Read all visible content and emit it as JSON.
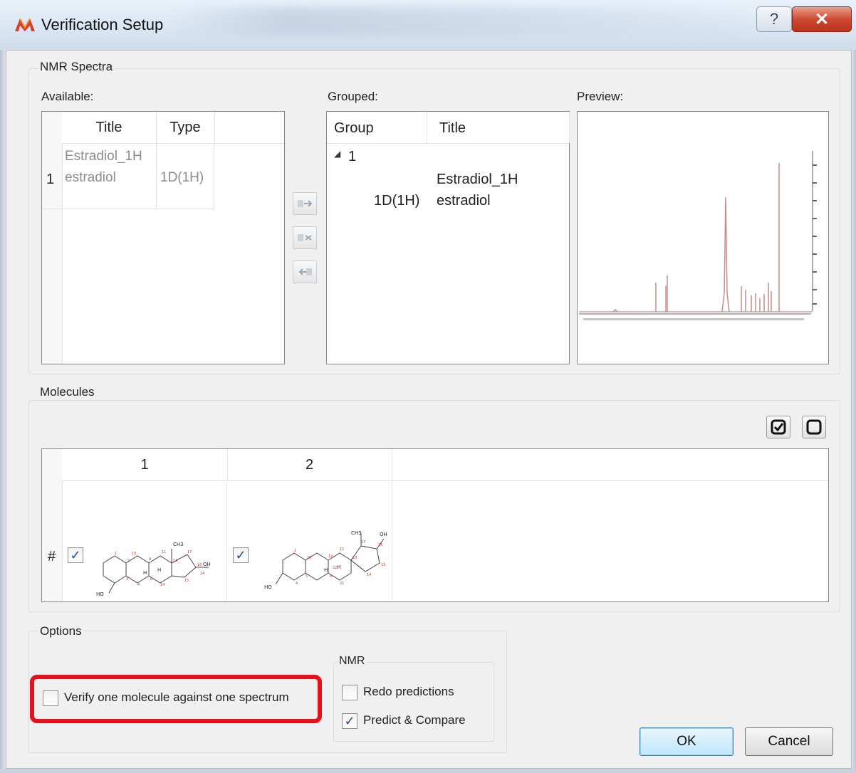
{
  "window": {
    "title": "Verification Setup",
    "help_glyph": "?",
    "close_glyph": "✕",
    "app_icon": "acd-logo-icon"
  },
  "nmr_spectra": {
    "group_label": "NMR Spectra",
    "available": {
      "label": "Available:",
      "columns": [
        "Title",
        "Type"
      ],
      "rows": [
        {
          "index": "1",
          "title_line1": "Estradiol_1H",
          "title_line2": "estradiol",
          "type": "1D(1H)"
        }
      ]
    },
    "transfer_buttons": [
      "add-to-group-icon",
      "remove-from-group-icon",
      "ungroup-icon"
    ],
    "grouped": {
      "label": "Grouped:",
      "columns": [
        "Group",
        "Title"
      ],
      "group_node": "1",
      "expander_glyph": "◢",
      "child": {
        "title_line1": "Estradiol_1H",
        "type": "1D(1H)",
        "title_line2": "estradiol"
      }
    },
    "preview": {
      "label": "Preview:"
    }
  },
  "molecules": {
    "group_label": "Molecules",
    "check_all_icon": "check-all-icon",
    "uncheck_all_icon": "uncheck-all-icon",
    "columns": [
      "1",
      "2"
    ],
    "row_header": "#",
    "items": [
      {
        "checked": true,
        "check_glyph": "✓",
        "mol_label_ho": "HO",
        "mol_label_ch3": "CH3",
        "mol_label_oh": "OH"
      },
      {
        "checked": true,
        "check_glyph": "✓",
        "mol_label_ho": "HO",
        "mol_label_ch3": "CH3",
        "mol_label_oh": "OH"
      }
    ]
  },
  "options": {
    "group_label": "Options",
    "verify_one": {
      "label": "Verify one molecule against one spectrum",
      "checked": false
    },
    "nmr": {
      "group_label": "NMR",
      "redo_predictions": {
        "label": "Redo predictions",
        "checked": false
      },
      "predict_compare": {
        "label": "Predict & Compare",
        "checked": true,
        "check_glyph": "✓"
      }
    }
  },
  "buttons": {
    "ok": "OK",
    "cancel": "Cancel"
  },
  "colors": {
    "highlight": "#e8101b",
    "spectrum_line": "#c98a8a",
    "atom_numbers": "#c0392b"
  }
}
